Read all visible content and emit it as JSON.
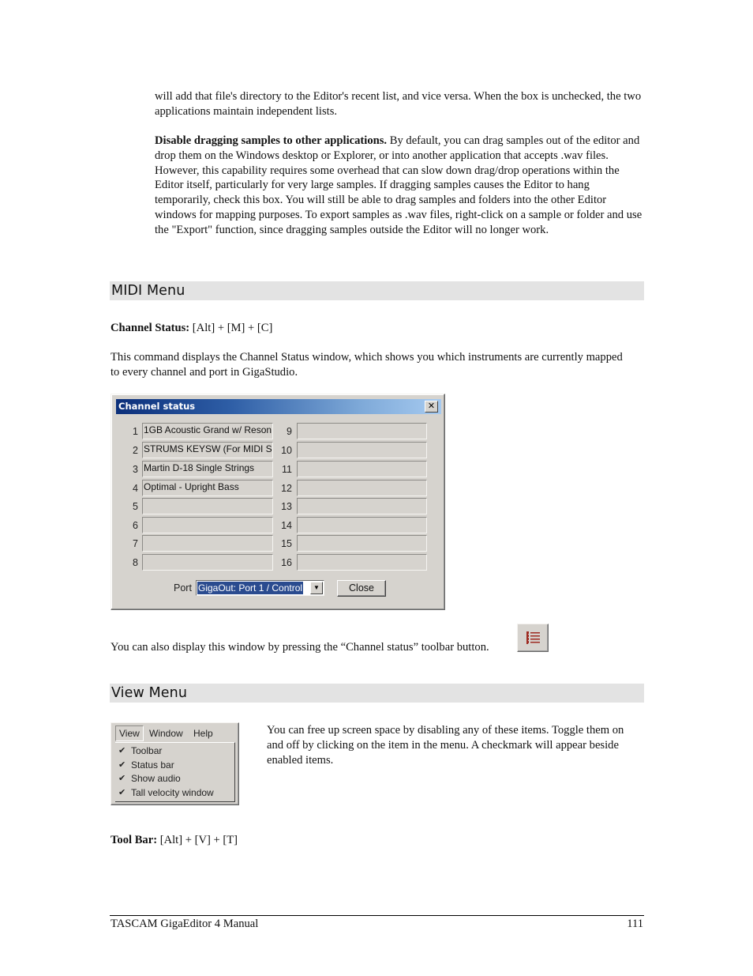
{
  "intro": {
    "continuation": "will add that file's directory to the Editor's recent list, and vice versa.  When the box is unchecked, the two applications maintain independent lists.",
    "disable_drag_title": "Disable dragging samples to other applications.",
    "disable_drag_text": " By default, you can drag samples out of the editor and drop them on the Windows desktop or Explorer, or into another application that accepts .wav files.  However, this capability requires some overhead that can slow down drag/drop operations within the Editor itself, particularly for very large samples.  If dragging samples causes the Editor to hang temporarily, check this box.  You will still be able to drag samples and folders into the other Editor windows for mapping purposes.  To export samples as .wav files, right-click on a sample or folder and use the \"Export\" function, since dragging samples outside the Editor will no longer work."
  },
  "midi_section": {
    "heading": "MIDI Menu",
    "channel_status_label": "Channel Status:",
    "channel_status_shortcut": " [Alt] + [M] + [C]",
    "description": "This command displays the Channel Status window, which shows you which instruments are currently mapped to every channel and port in GigaStudio.",
    "toolbar_note": "You can also display this window by pressing the “Channel status” toolbar button.",
    "toolbar_icon": "channel-status-list-icon"
  },
  "dialog": {
    "title": "Channel status",
    "close_glyph": "✕",
    "channels": [
      {
        "num": "1",
        "value": "1GB Acoustic Grand w/ Reson"
      },
      {
        "num": "2",
        "value": "STRUMS KEYSW (For MIDI S"
      },
      {
        "num": "3",
        "value": "Martin D-18 Single Strings"
      },
      {
        "num": "4",
        "value": "Optimal - Upright Bass"
      },
      {
        "num": "5",
        "value": ""
      },
      {
        "num": "6",
        "value": ""
      },
      {
        "num": "7",
        "value": ""
      },
      {
        "num": "8",
        "value": ""
      },
      {
        "num": "9",
        "value": ""
      },
      {
        "num": "10",
        "value": ""
      },
      {
        "num": "11",
        "value": ""
      },
      {
        "num": "12",
        "value": ""
      },
      {
        "num": "13",
        "value": ""
      },
      {
        "num": "14",
        "value": ""
      },
      {
        "num": "15",
        "value": ""
      },
      {
        "num": "16",
        "value": ""
      }
    ],
    "port_label": "Port",
    "port_value": "GigaOut: Port 1 / Control",
    "dropdown_glyph": "▼",
    "close_button": "Close"
  },
  "view_section": {
    "heading": "View Menu",
    "menubar": [
      "View",
      "Window",
      "Help"
    ],
    "menu_items": [
      {
        "label": "Toolbar",
        "checked": true
      },
      {
        "label": "Status bar",
        "checked": true
      },
      {
        "label": "Show audio",
        "checked": true
      },
      {
        "label": "Tall velocity window",
        "checked": true
      }
    ],
    "check_glyph": "✔",
    "description": "You can free up screen space by disabling any of these items. Toggle them on and off by clicking on the item in the menu. A checkmark will appear beside enabled items.",
    "toolbar_label": "Tool Bar:",
    "toolbar_shortcut": " [Alt] + [V] + [T]"
  },
  "footer": {
    "title": "TASCAM GigaEditor 4 Manual",
    "page_number": "111"
  }
}
